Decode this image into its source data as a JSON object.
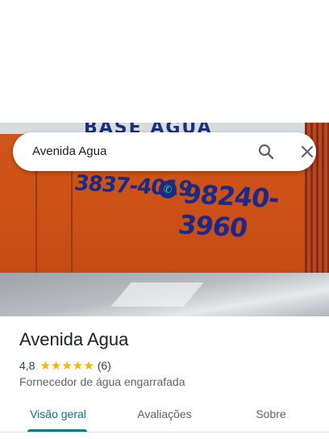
{
  "search": {
    "query": "Avenida Agua"
  },
  "hero_photo": {
    "sign_text": "BASE AGUA",
    "phone_1": "3837-4019",
    "phone_2": "98240-3960"
  },
  "place": {
    "title": "Avenida Agua",
    "rating": "4,8",
    "stars": "★★★★★",
    "review_count": "(6)",
    "category": "Fornecedor de água engarrafada"
  },
  "tabs": [
    {
      "label": "Visão geral",
      "active": true
    },
    {
      "label": "Avaliações",
      "active": false
    },
    {
      "label": "Sobre",
      "active": false
    }
  ],
  "colors": {
    "accent": "#007b83",
    "star": "#f7b500"
  }
}
